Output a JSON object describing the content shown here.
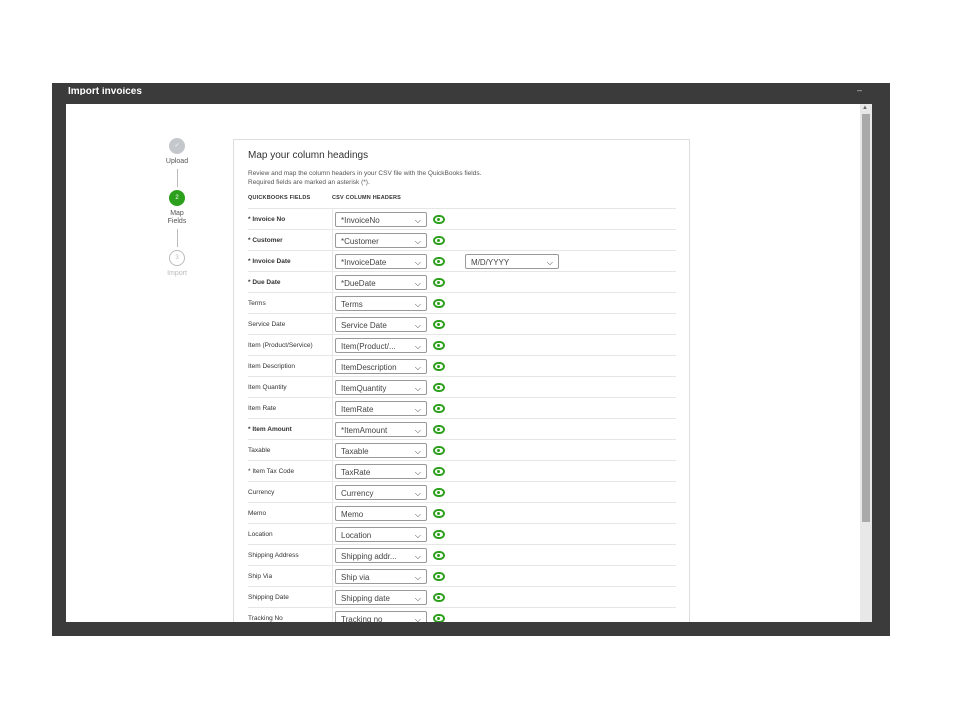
{
  "window": {
    "title": "Import invoices",
    "minimize": "–"
  },
  "steps": [
    {
      "label": "Upload",
      "icon": "✓",
      "state": "done"
    },
    {
      "label": "Map Fields",
      "number": "2",
      "state": "active"
    },
    {
      "label": "Import",
      "number": "3",
      "state": "pending"
    }
  ],
  "card": {
    "title": "Map your column headings",
    "desc1": "Review and map the column headers in your CSV file with the QuickBooks fields.",
    "desc2": "Required fields are marked an asterisk (*).",
    "col1": "QUICKBOOKS FIELDS",
    "col2": "CSV COLUMN HEADERS"
  },
  "date_format": "M/D/YYYY",
  "colors": {
    "accent": "#2ca01c"
  },
  "rows": [
    {
      "field": "* Invoice No",
      "value": "*InvoiceNo",
      "required": true
    },
    {
      "field": "* Customer",
      "value": "*Customer",
      "required": true
    },
    {
      "field": "* Invoice Date",
      "value": "*InvoiceDate",
      "required": true
    },
    {
      "field": "* Due Date",
      "value": "*DueDate",
      "required": true
    },
    {
      "field": "Terms",
      "value": "Terms"
    },
    {
      "field": "Service Date",
      "value": "Service Date"
    },
    {
      "field": "Item (Product/Service)",
      "value": "Item(Product/..."
    },
    {
      "field": "Item Description",
      "value": "ItemDescription"
    },
    {
      "field": "Item Quantity",
      "value": "ItemQuantity"
    },
    {
      "field": "Item Rate",
      "value": "ItemRate"
    },
    {
      "field": "* Item Amount",
      "value": "*ItemAmount",
      "required": true
    },
    {
      "field": "Taxable",
      "value": "Taxable"
    },
    {
      "field": "* Item Tax Code",
      "value": "TaxRate"
    },
    {
      "field": "Currency",
      "value": "Currency"
    },
    {
      "field": "Memo",
      "value": "Memo"
    },
    {
      "field": "Location",
      "value": "Location"
    },
    {
      "field": "Shipping Address",
      "value": "Shipping addr..."
    },
    {
      "field": "Ship Via",
      "value": "Ship via"
    },
    {
      "field": "Shipping Date",
      "value": "Shipping date"
    },
    {
      "field": "Tracking No",
      "value": "Tracking no"
    }
  ]
}
